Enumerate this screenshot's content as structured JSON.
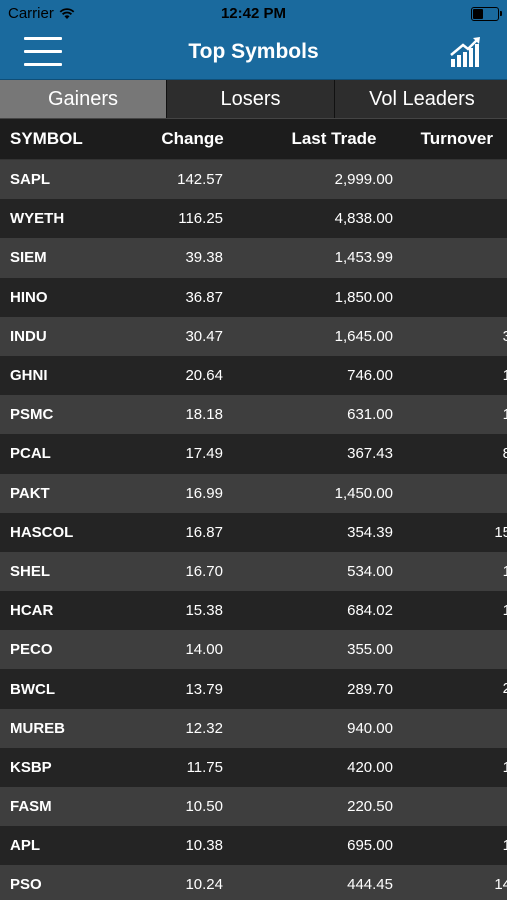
{
  "status": {
    "carrier": "Carrier",
    "time": "12:42 PM"
  },
  "nav": {
    "title": "Top Symbols",
    "menu_icon": "hamburger-menu-icon",
    "chart_icon": "bar-chart-trend-icon"
  },
  "tabs": [
    {
      "label": "Gainers",
      "selected": true
    },
    {
      "label": "Losers",
      "selected": false
    },
    {
      "label": "Vol Leaders",
      "selected": false
    }
  ],
  "table": {
    "headers": {
      "symbol": "SYMBOL",
      "change": "Change",
      "last": "Last Trade",
      "turnover": "Turnover"
    },
    "rows": [
      {
        "symbol": "SAPL",
        "change": "142.57",
        "last": "2,999.00",
        "turnover": ""
      },
      {
        "symbol": "WYETH",
        "change": "116.25",
        "last": "4,838.00",
        "turnover": ""
      },
      {
        "symbol": "SIEM",
        "change": "39.38",
        "last": "1,453.99",
        "turnover": ""
      },
      {
        "symbol": "HINO",
        "change": "36.87",
        "last": "1,850.00",
        "turnover": ""
      },
      {
        "symbol": "INDU",
        "change": "30.47",
        "last": "1,645.00",
        "turnover": "3"
      },
      {
        "symbol": "GHNI",
        "change": "20.64",
        "last": "746.00",
        "turnover": "1"
      },
      {
        "symbol": "PSMC",
        "change": "18.18",
        "last": "631.00",
        "turnover": "1"
      },
      {
        "symbol": "PCAL",
        "change": "17.49",
        "last": "367.43",
        "turnover": "8"
      },
      {
        "symbol": "PAKT",
        "change": "16.99",
        "last": "1,450.00",
        "turnover": ""
      },
      {
        "symbol": "HASCOL",
        "change": "16.87",
        "last": "354.39",
        "turnover": "15"
      },
      {
        "symbol": "SHEL",
        "change": "16.70",
        "last": "534.00",
        "turnover": "1"
      },
      {
        "symbol": "HCAR",
        "change": "15.38",
        "last": "684.02",
        "turnover": "1"
      },
      {
        "symbol": "PECO",
        "change": "14.00",
        "last": "355.00",
        "turnover": ""
      },
      {
        "symbol": "BWCL",
        "change": "13.79",
        "last": "289.70",
        "turnover": "2"
      },
      {
        "symbol": "MUREB",
        "change": "12.32",
        "last": "940.00",
        "turnover": ""
      },
      {
        "symbol": "KSBP",
        "change": "11.75",
        "last": "420.00",
        "turnover": "1"
      },
      {
        "symbol": "FASM",
        "change": "10.50",
        "last": "220.50",
        "turnover": ""
      },
      {
        "symbol": "APL",
        "change": "10.38",
        "last": "695.00",
        "turnover": "1"
      },
      {
        "symbol": "PSO",
        "change": "10.24",
        "last": "444.45",
        "turnover": "14"
      }
    ]
  }
}
